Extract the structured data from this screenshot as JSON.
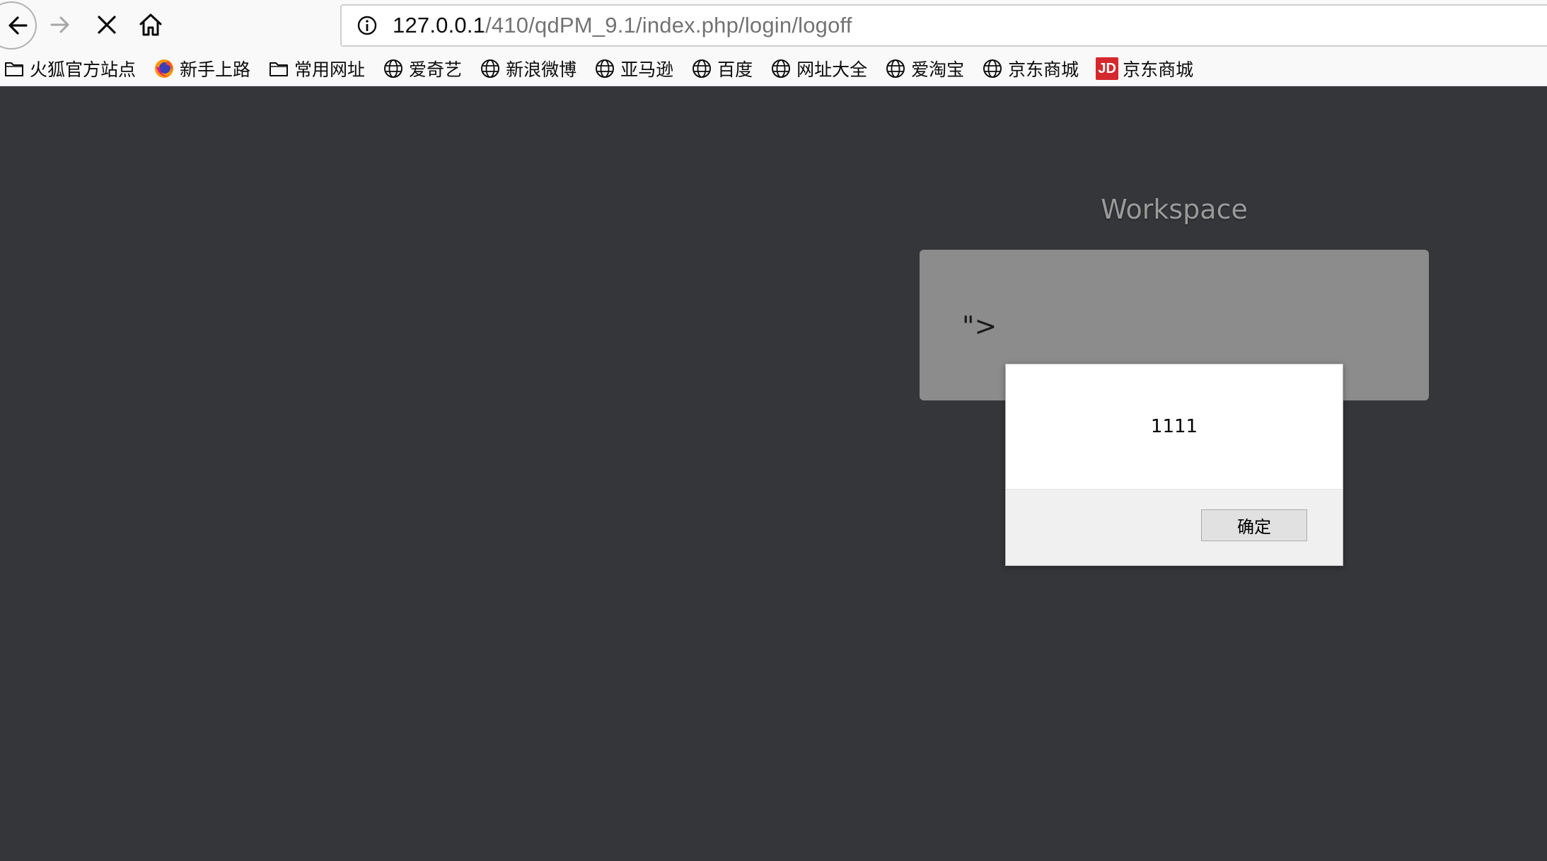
{
  "browser": {
    "url_host": "127.0.0.1",
    "url_path": "/410/qdPM_9.1/index.php/login/logoff",
    "bookmarks": [
      {
        "label": "火狐官方站点",
        "icon": "folder-icon"
      },
      {
        "label": "新手上路",
        "icon": "firefox-icon"
      },
      {
        "label": "常用网址",
        "icon": "folder-icon"
      },
      {
        "label": "爱奇艺",
        "icon": "globe-icon"
      },
      {
        "label": "新浪微博",
        "icon": "globe-icon"
      },
      {
        "label": "亚马逊",
        "icon": "globe-icon"
      },
      {
        "label": "百度",
        "icon": "globe-icon"
      },
      {
        "label": "网址大全",
        "icon": "globe-icon"
      },
      {
        "label": "爱淘宝",
        "icon": "globe-icon"
      },
      {
        "label": "京东商城",
        "icon": "globe-icon"
      },
      {
        "label": "京东商城",
        "icon": "jd-icon",
        "icon_text": "JD"
      }
    ]
  },
  "page": {
    "workspace_title": "Workspace",
    "injected_text": "\">"
  },
  "dialog": {
    "message": "1111",
    "ok_label": "确定"
  },
  "colors": {
    "page_background": "#35363a",
    "panel_background": "#8c8c8c",
    "jd_red": "#d4282d"
  }
}
